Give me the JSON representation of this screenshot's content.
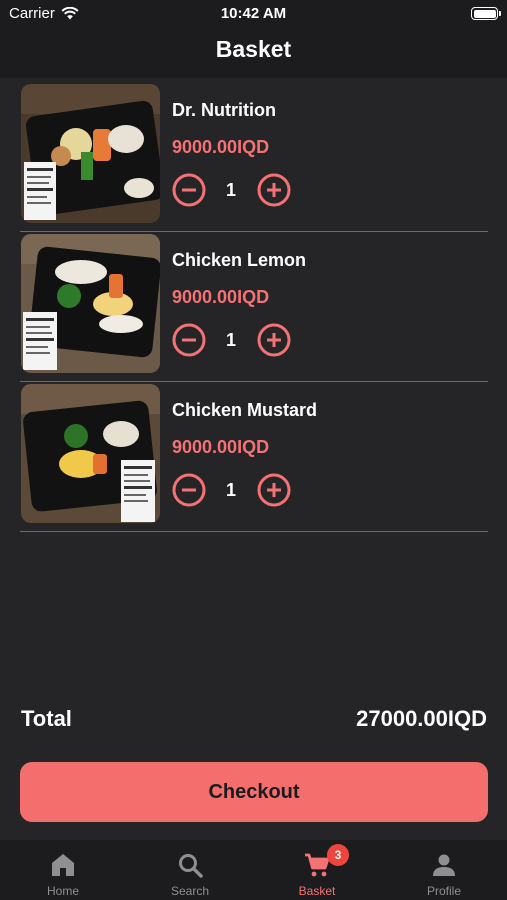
{
  "status_bar": {
    "carrier": "Carrier",
    "time": "10:42 AM"
  },
  "header": {
    "title": "Basket"
  },
  "basket": {
    "items": [
      {
        "name": "Dr. Nutrition",
        "price": "9000.00IQD",
        "quantity": "1",
        "image": "meal-box-photo"
      },
      {
        "name": "Chicken Lemon",
        "price": "9000.00IQD",
        "quantity": "1",
        "image": "meal-box-photo"
      },
      {
        "name": "Chicken Mustard",
        "price": "9000.00IQD",
        "quantity": "1",
        "image": "meal-box-photo"
      }
    ]
  },
  "summary": {
    "total_label": "Total",
    "total_value": "27000.00IQD",
    "checkout_label": "Checkout"
  },
  "tabbar": {
    "tabs": [
      {
        "label": "Home",
        "icon": "home-icon",
        "active": false
      },
      {
        "label": "Search",
        "icon": "search-icon",
        "active": false
      },
      {
        "label": "Basket",
        "icon": "cart-icon",
        "active": true,
        "badge": "3"
      },
      {
        "label": "Profile",
        "icon": "person-icon",
        "active": false
      }
    ]
  },
  "colors": {
    "background": "#252528",
    "bar_background": "#1c1c1e",
    "accent": "#f47274",
    "checkout_button": "#f56e6e",
    "badge": "#f0453f",
    "inactive_tab": "#8e8e93"
  }
}
